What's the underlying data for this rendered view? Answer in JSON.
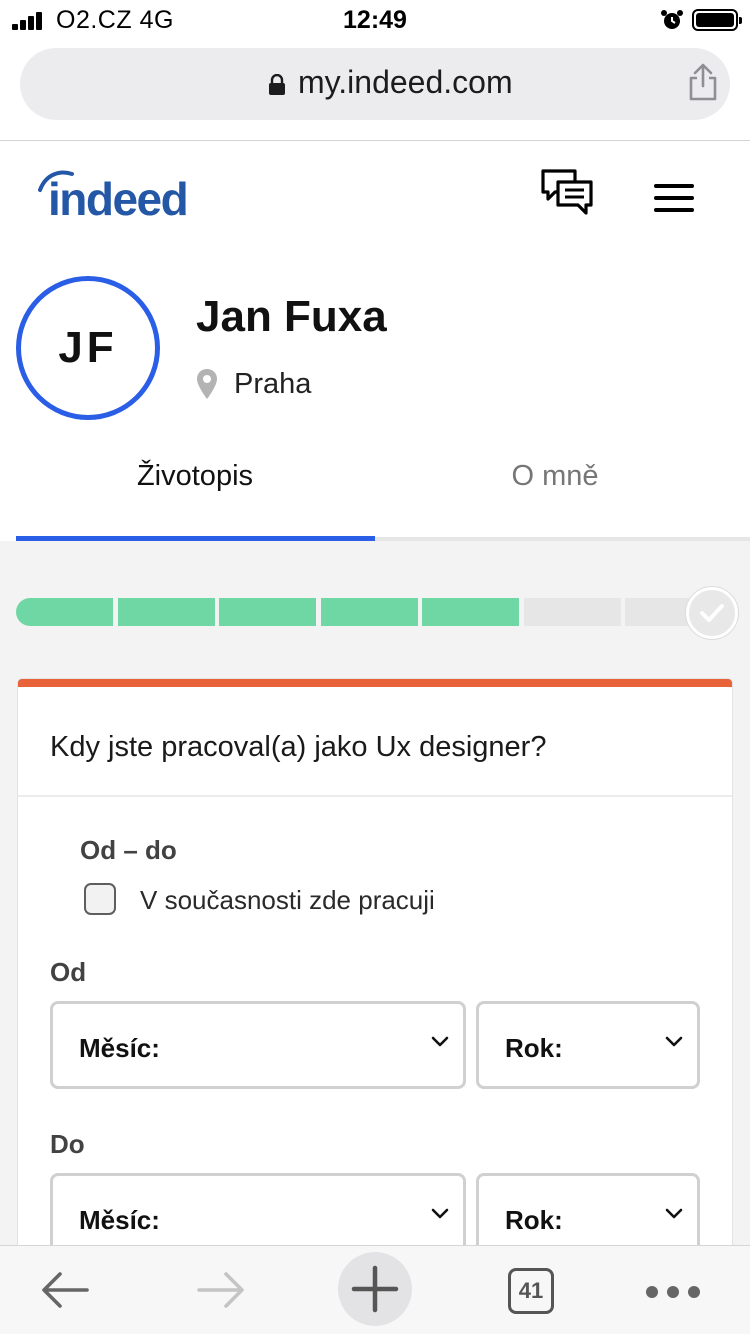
{
  "status_bar": {
    "carrier": "O2.CZ   4G",
    "time": "12:49"
  },
  "browser": {
    "url": "my.indeed.com"
  },
  "header": {
    "logo": "indeed"
  },
  "profile": {
    "initials": "JF",
    "name": "Jan Fuxa",
    "location": "Praha"
  },
  "tabs": [
    {
      "label": "Životopis",
      "active": true
    },
    {
      "label": "O mně",
      "active": false
    }
  ],
  "progress": {
    "completed_steps": 5,
    "total_steps": 7
  },
  "card": {
    "question": "Kdy jste pracoval(a) jako Ux designer?",
    "range_label": "Od – do",
    "current_job_label": "V současnosti zde pracuji",
    "current_job_checked": false,
    "from_label": "Od",
    "to_label": "Do",
    "from_month": "Měsíc:",
    "from_year": "Rok:",
    "to_month": "Měsíc:",
    "to_year": "Rok:"
  },
  "toolbar": {
    "tab_count": "41"
  },
  "colors": {
    "brand_blue": "#2557a7",
    "accent_blue": "#2a5ee6",
    "progress_green": "#6fd7a4",
    "card_accent": "#e8623a"
  }
}
